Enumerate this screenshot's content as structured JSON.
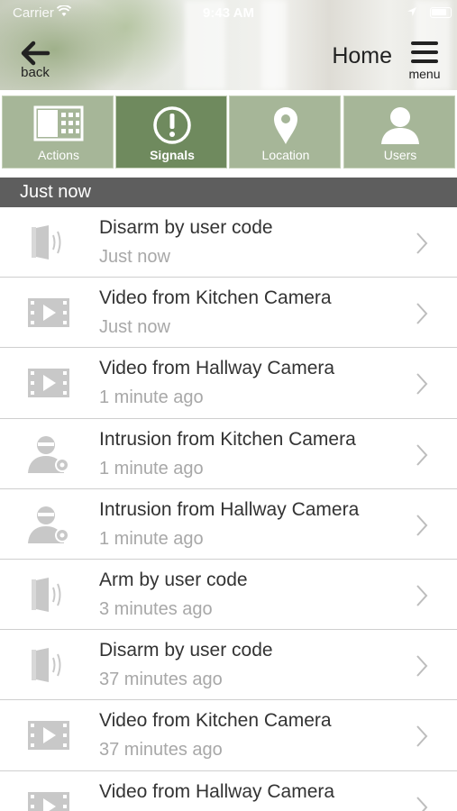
{
  "status_bar": {
    "carrier": "Carrier",
    "time": "9:43 AM"
  },
  "header": {
    "back_label": "back",
    "title": "Home",
    "menu_label": "menu"
  },
  "tabs": [
    {
      "label": "Actions",
      "icon": "actions-grid-icon",
      "active": false
    },
    {
      "label": "Signals",
      "icon": "exclamation-circle-icon",
      "active": true
    },
    {
      "label": "Location",
      "icon": "map-pin-icon",
      "active": false
    },
    {
      "label": "Users",
      "icon": "user-icon",
      "active": false
    }
  ],
  "section": {
    "title": "Just now"
  },
  "signals": [
    {
      "title": "Disarm by user code",
      "time": "Just now",
      "icon": "door-sensor-icon"
    },
    {
      "title": "Video from Kitchen Camera",
      "time": "Just now",
      "icon": "video-clip-icon"
    },
    {
      "title": "Video from Hallway Camera",
      "time": "1 minute ago",
      "icon": "video-clip-icon"
    },
    {
      "title": "Intrusion from Kitchen Camera",
      "time": "1 minute ago",
      "icon": "intruder-icon"
    },
    {
      "title": "Intrusion from Hallway Camera",
      "time": "1 minute ago",
      "icon": "intruder-icon"
    },
    {
      "title": "Arm by user code",
      "time": "3 minutes ago",
      "icon": "door-sensor-icon"
    },
    {
      "title": "Disarm by user code",
      "time": "37 minutes ago",
      "icon": "door-sensor-icon"
    },
    {
      "title": "Video from Kitchen Camera",
      "time": "37 minutes ago",
      "icon": "video-clip-icon"
    },
    {
      "title": "Video from Hallway Camera",
      "time": "",
      "icon": "video-clip-icon"
    }
  ],
  "colors": {
    "tab_bg": "#a6b698",
    "tab_active_bg": "#6f8a5e",
    "section_bg": "#5e5e5e",
    "icon_gray": "#c8c8c8"
  }
}
